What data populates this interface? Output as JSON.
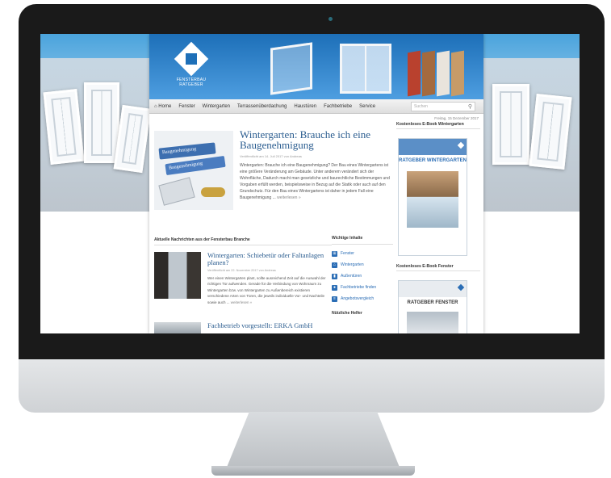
{
  "site": {
    "logo_line1": "FENSTERBAU",
    "logo_line2": "RATGEBER",
    "brand_color": "#1d6fb8"
  },
  "nav": {
    "items": [
      "Home",
      "Fenster",
      "Wintergarten",
      "Terrassenüberdachung",
      "Haustüren",
      "Fachbetriebe",
      "Service"
    ],
    "search_placeholder": "Suchen",
    "home_icon": "home-icon",
    "search_icon": "search-icon"
  },
  "date": "Freitag, 15 Dezember 2017",
  "featured": {
    "title": "Wintergarten: Brauche ich eine Baugenehmigung",
    "meta": "Veröffentlicht am 14. Juli 2017 von Andreas",
    "text": "Wintergarten: Brauche ich eine Baugenehmigung? Der Bau eines Wintergartens ist eine größere Veränderung am Gebäude. Unter anderem verändert sich der Wohnfläche, Dadurch macht man gesetzliche und baurechtliche Bestimmungen und Vorgaben erfüllt werden, beispielsweise in Bezug auf die Statik oder auch auf den Grundschutz. Für den Bau eines Wintergartens ist daher in jedem Fall eine Baugenehmigung ...",
    "more": "weiterlesen »",
    "binder1": "Baugenehmigung",
    "binder2": "Baugenehmigung"
  },
  "sidebar": {
    "ebook1_head": "Kostenloses E-Book Wintergarten",
    "ebook1_title": "RATGEBER WINTERGARTEN",
    "ebook2_head": "Kostenloses E-Book Fenster",
    "ebook2_title": "RATGEBER FENSTER"
  },
  "news": {
    "heading": "Aktuelle Nachrichten aus der Fensterbau Branche",
    "items": [
      {
        "title": "Wintergarten: Schiebetür oder Faltanlagen planen?",
        "meta": "Veröffentlicht am 22. November 2017 von Andreas",
        "text": "Wer einen Wintergarten plant, sollte ausreichend Zeit auf die Auswahl der richtigen Tür aufwenden. Gerade für die Verbindung von Wohnraum zu Wintergarten bzw. von Wintergarten zu Außenbereich existieren verschiedene Arten von Türen, die jeweils individuelle Vor- und Nachteile sowie auch ...",
        "more": "weiterlesen »"
      },
      {
        "title": "Fachbetrieb vorgestellt: ERKA GmbH"
      }
    ]
  },
  "important": {
    "heading": "Wichtige Inhalte",
    "items": [
      "Fenster",
      "Wintergarten",
      "Außentüren",
      "Fachbetriebe finden",
      "Angebotsvergleich"
    ],
    "helper_heading": "Nützliche Helfer"
  }
}
